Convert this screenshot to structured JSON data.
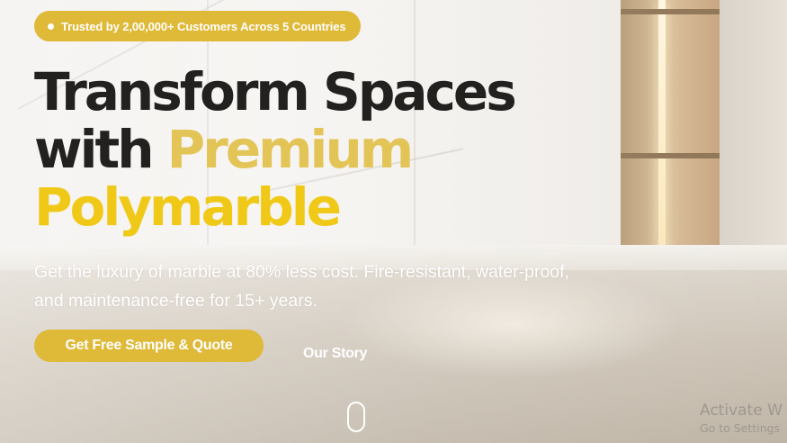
{
  "hero": {
    "badge": "Trusted by 2,00,000+ Customers Across 5 Countries",
    "headline": {
      "line1": "Transform Spaces",
      "line2_plain": "with ",
      "line2_accent": "Premium",
      "line3_accent": "Polymarble"
    },
    "subtext": "Get the luxury of marble at 80% less cost. Fire-resistant, water-proof, and maintenance-free for 15+ years.",
    "cta_primary": "Get Free Sample & Quote",
    "cta_secondary": "Our Story"
  },
  "watermark": {
    "title": "Activate W",
    "subtitle": "Go to Settings"
  },
  "colors": {
    "accent": "#dfb938",
    "accent_text_light": "#e3c457",
    "accent_text_bright": "#f0c918",
    "headline_dark": "#23211f"
  },
  "icons": {
    "badge_bullet": "dot-icon",
    "scroll": "mouse-scroll-icon"
  }
}
